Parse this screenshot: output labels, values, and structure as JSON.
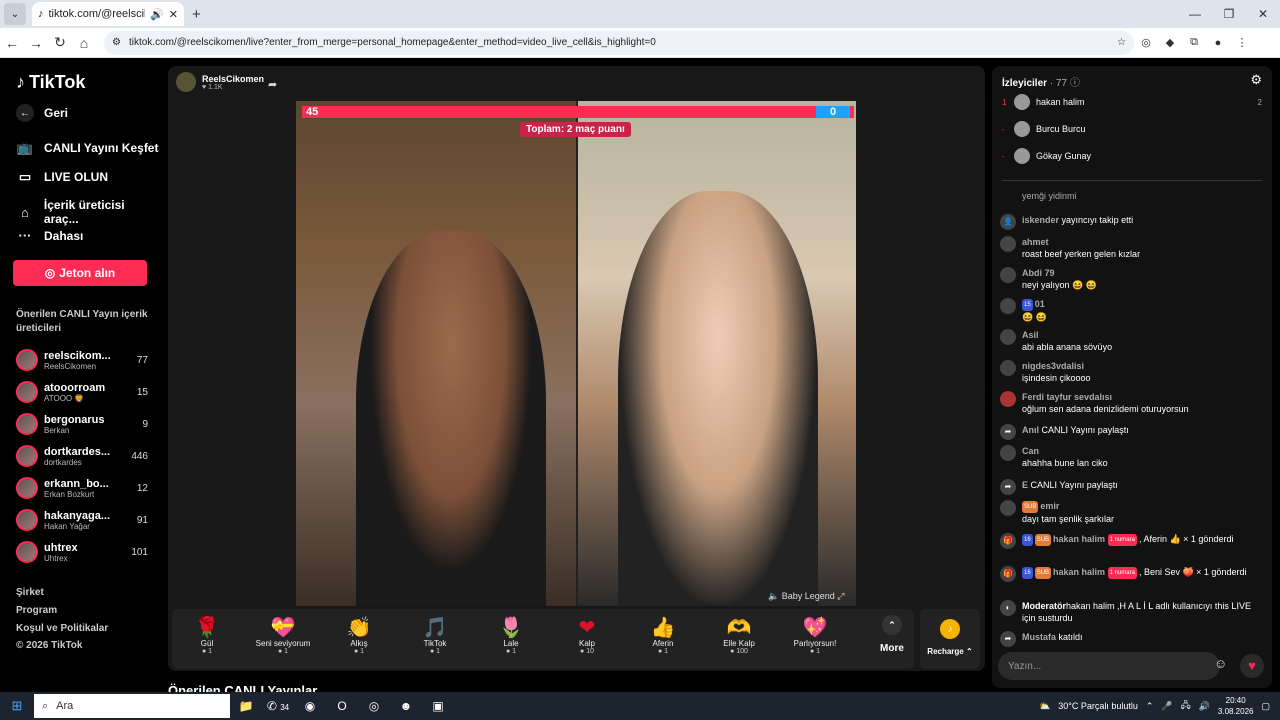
{
  "browser": {
    "tab_title": "tiktok.com/@reelscikomen",
    "url": "tiktok.com/@reelscikomen/live?enter_from_merge=personal_homepage&enter_method=video_live_cell&is_highlight=0"
  },
  "sidebar": {
    "logo": "TikTok",
    "back": "Geri",
    "items": [
      {
        "label": "CANLI Yayını Keşfet",
        "icon": "live-explore-icon"
      },
      {
        "label": "LIVE OLUN",
        "icon": "camera-icon"
      },
      {
        "label": "İçerik üreticisi araç...",
        "icon": "creator-tools-icon"
      },
      {
        "label": "Dahası",
        "icon": "more-dots-icon"
      }
    ],
    "jeton_button": "Jeton alın",
    "suggested_title": "Önerilen CANLI Yayın içerik üreticileri",
    "creators": [
      {
        "name": "reelscikom...",
        "sub": "ReelsCikomen",
        "count": "77"
      },
      {
        "name": "atooorroam",
        "sub": "ATOOO 🦁",
        "count": "15"
      },
      {
        "name": "bergonarus",
        "sub": "Berkan",
        "count": "9"
      },
      {
        "name": "dortkardes...",
        "sub": "dortkardes",
        "count": "446"
      },
      {
        "name": "erkann_bo...",
        "sub": "Erkan Bozkurt",
        "count": "12"
      },
      {
        "name": "hakanyaga...",
        "sub": "Hakan Yağar",
        "count": "91"
      },
      {
        "name": "uhtrex",
        "sub": "Uhtrex",
        "count": "101"
      }
    ],
    "footer": [
      "Şirket",
      "Program",
      "Koşul ve Politikalar",
      "© 2026 TikTok"
    ]
  },
  "stream": {
    "host_name": "ReelsCikomen",
    "host_likes": "1.1K",
    "score_left": "45",
    "score_right": "0",
    "total_label": "Toplam: 2 maç puanı",
    "baby_legend": "Baby Legend",
    "bottom_title": "Önerilen CANLI Yayınlar"
  },
  "gifts": [
    {
      "name": "Gül",
      "price": "1",
      "icon": "🌹"
    },
    {
      "name": "Seni seviyorum",
      "price": "1",
      "icon": "💝"
    },
    {
      "name": "Alkış",
      "price": "1",
      "icon": "👏"
    },
    {
      "name": "TikTok",
      "price": "1",
      "icon": "🎵"
    },
    {
      "name": "Lale",
      "price": "1",
      "icon": "🌷"
    },
    {
      "name": "Kalp",
      "price": "10",
      "icon": "❤"
    },
    {
      "name": "Aferin",
      "price": "1",
      "icon": "👍"
    },
    {
      "name": "Elle Kalp",
      "price": "100",
      "icon": "🫶"
    },
    {
      "name": "Parlıyorsun!",
      "price": "1",
      "icon": "💖"
    }
  ],
  "more_label": "More",
  "recharge_label": "Recharge",
  "chat": {
    "viewers_label": "İzleyiciler",
    "viewers_count": "· 77",
    "viewers": [
      {
        "rank": "1",
        "name": "hakan halim",
        "score": "2"
      },
      {
        "rank": "-",
        "name": "Burcu Burcu",
        "score": ""
      },
      {
        "rank": "-",
        "name": "Gökay Gunay",
        "score": ""
      }
    ],
    "messages": [
      {
        "user": "",
        "text": "yemği yidinmi"
      },
      {
        "user": "iskender",
        "text": "yayıncıyı takip etti"
      },
      {
        "user": "ahmet",
        "text": "roast beef yerken gelen kızlar"
      },
      {
        "user": "Abdi 79",
        "text": "neyi yalıyon 😆 😆"
      },
      {
        "user": "01",
        "text": "😆 😆"
      },
      {
        "user": "Asil",
        "text": "abi abla anana sövüyo"
      },
      {
        "user": "nigdes3vdalisi",
        "text": "işindesin çikoooo"
      },
      {
        "user": "Ferdi tayfur sevdalısı",
        "text": "oğlum sen adana denizlidemi oturuyorsun"
      },
      {
        "user": "Anıl",
        "text": "CANLI Yayını paylaştı"
      },
      {
        "user": "Can",
        "text": "ahahha bune lan ciko"
      },
      {
        "user": "E",
        "text": "CANLI Yayını paylaştı"
      },
      {
        "user": "emir",
        "text": "dayı tam şenlik şarkılar"
      },
      {
        "user": "hakan halim",
        "text": ", Aferin 👍 × 1 gönderdi"
      },
      {
        "user": "hakan halim",
        "text": ", Beni Sev 🍑 × 1 gönderdi"
      },
      {
        "user": "Moderatör",
        "text": "hakan halim ,H A L İ L adlı kullanıcıyı this LIVE için susturdu"
      },
      {
        "user": "Mustafa",
        "text": "katıldı"
      }
    ],
    "input_placeholder": "Yazın..."
  },
  "taskbar": {
    "search": "Ara",
    "weather": "30°C  Parçalı bulutlu",
    "time": "20:40",
    "date": "3.08.2026",
    "badge": "34"
  }
}
